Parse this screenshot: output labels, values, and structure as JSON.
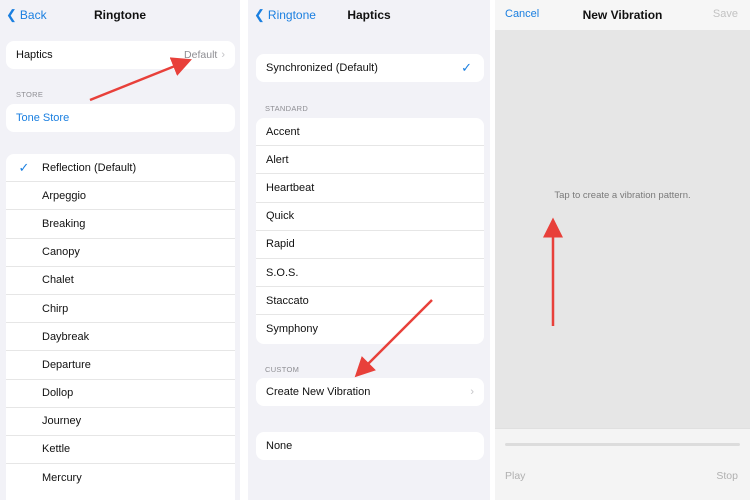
{
  "panel1": {
    "back_label": "Back",
    "title": "Ringtone",
    "haptics": {
      "label": "Haptics",
      "value": "Default"
    },
    "store_header": "STORE",
    "tone_store_label": "Tone Store",
    "tones": [
      "Reflection (Default)",
      "Arpeggio",
      "Breaking",
      "Canopy",
      "Chalet",
      "Chirp",
      "Daybreak",
      "Departure",
      "Dollop",
      "Journey",
      "Kettle",
      "Mercury"
    ]
  },
  "panel2": {
    "back_label": "Ringtone",
    "title": "Haptics",
    "synchronized_label": "Synchronized (Default)",
    "standard_header": "STANDARD",
    "standard": [
      "Accent",
      "Alert",
      "Heartbeat",
      "Quick",
      "Rapid",
      "S.O.S.",
      "Staccato",
      "Symphony"
    ],
    "custom_header": "CUSTOM",
    "create_label": "Create New Vibration",
    "none_label": "None"
  },
  "panel3": {
    "cancel_label": "Cancel",
    "title": "New Vibration",
    "save_label": "Save",
    "hint": "Tap to create a vibration pattern.",
    "play_label": "Play",
    "stop_label": "Stop"
  },
  "colors": {
    "accent": "#1a7fe0",
    "annotation": "#e8403a"
  }
}
